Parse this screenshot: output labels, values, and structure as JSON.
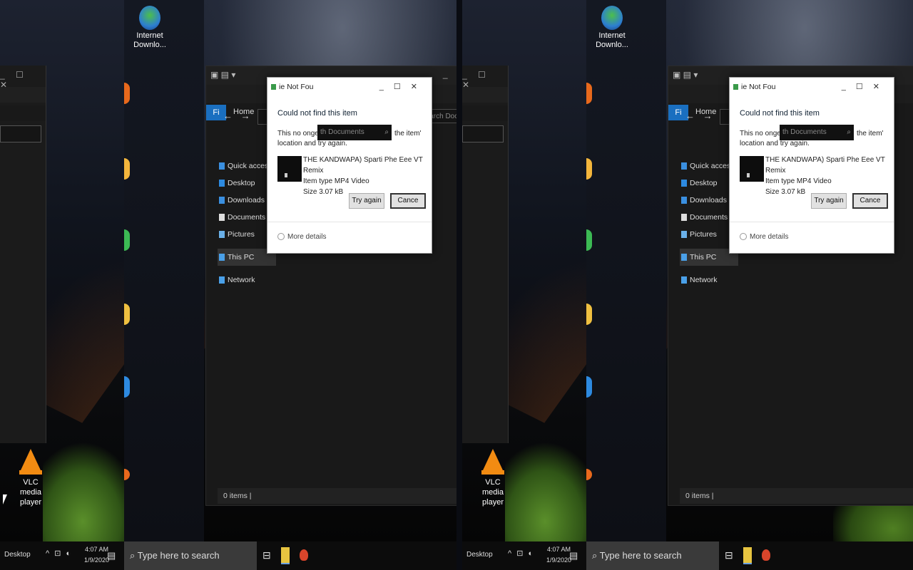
{
  "dialog": {
    "title": "ie Not Fou",
    "heading": "Could not find this item",
    "message_line1": "This no onger located",
    "message_mid": "th Documents",
    "message_line1_end": "the item'",
    "message_line2": "location and try again.",
    "file_name": "THE KANDWAPA) Sparti Phe Eee VT Remix",
    "file_type": "Item type MP4 Video",
    "file_size": "Size 3.07 kB",
    "try_again_button": "Try again",
    "cancel_button": "Cance",
    "more_info": "More details"
  },
  "explorer": {
    "file_tab": "Fi",
    "home_tab": "Home",
    "search_placeholder": "Search Documents",
    "status_text": "0 items |",
    "nav_items": [
      {
        "label": "Quick access",
        "icon": "star-icon"
      },
      {
        "label": "Desktop",
        "icon": "desktop-icon"
      },
      {
        "label": "Downloads",
        "icon": "download-icon"
      },
      {
        "label": "Documents",
        "icon": "document-icon"
      },
      {
        "label": "Pictures",
        "icon": "picture-icon"
      },
      {
        "label": "This PC",
        "icon": "computer-icon"
      },
      {
        "label": "Network",
        "icon": "network-icon"
      }
    ]
  },
  "desktop": {
    "icons": [
      {
        "label": "Internet Downlo...",
        "icon": "idm-icon"
      },
      {
        "label": "VLC media player",
        "icon": "vlc-icon"
      }
    ]
  },
  "taskbar": {
    "start_label": "Desktop",
    "search_placeholder": "Type here to search",
    "time": "4:07 AM",
    "date": "1/9/2020"
  },
  "colors": {
    "accent": "#1a6fc0",
    "dialog_bg": "#ffffff",
    "explorer_bg": "#191919"
  }
}
